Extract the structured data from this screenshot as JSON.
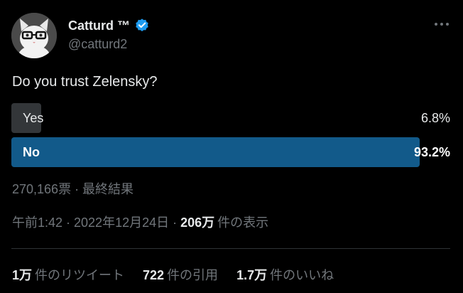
{
  "author": {
    "name": "Catturd ™",
    "handle": "@catturd2"
  },
  "tweet": {
    "text": "Do you trust Zelensky?"
  },
  "poll": {
    "options": [
      {
        "label": "Yes",
        "percent": "6.8%",
        "value": 6.8
      },
      {
        "label": "No",
        "percent": "93.2%",
        "value": 93.2
      }
    ],
    "votes": "270,166票 · 最終結果"
  },
  "meta": {
    "time": "午前1:42 · 2022年12月24日 ·",
    "views_count": "206万",
    "views_label": "件の表示"
  },
  "stats": {
    "retweets_count": "1万",
    "retweets_label": "件のリツイート",
    "quotes_count": "722",
    "quotes_label": "件の引用",
    "likes_count": "1.7万",
    "likes_label": "件のいいね"
  },
  "colors": {
    "background": "#000000",
    "text": "#e7e9ea",
    "muted": "#71767b",
    "winning_bar": "#125a8a",
    "losing_bar": "#333639",
    "verified": "#1d9bf0"
  }
}
